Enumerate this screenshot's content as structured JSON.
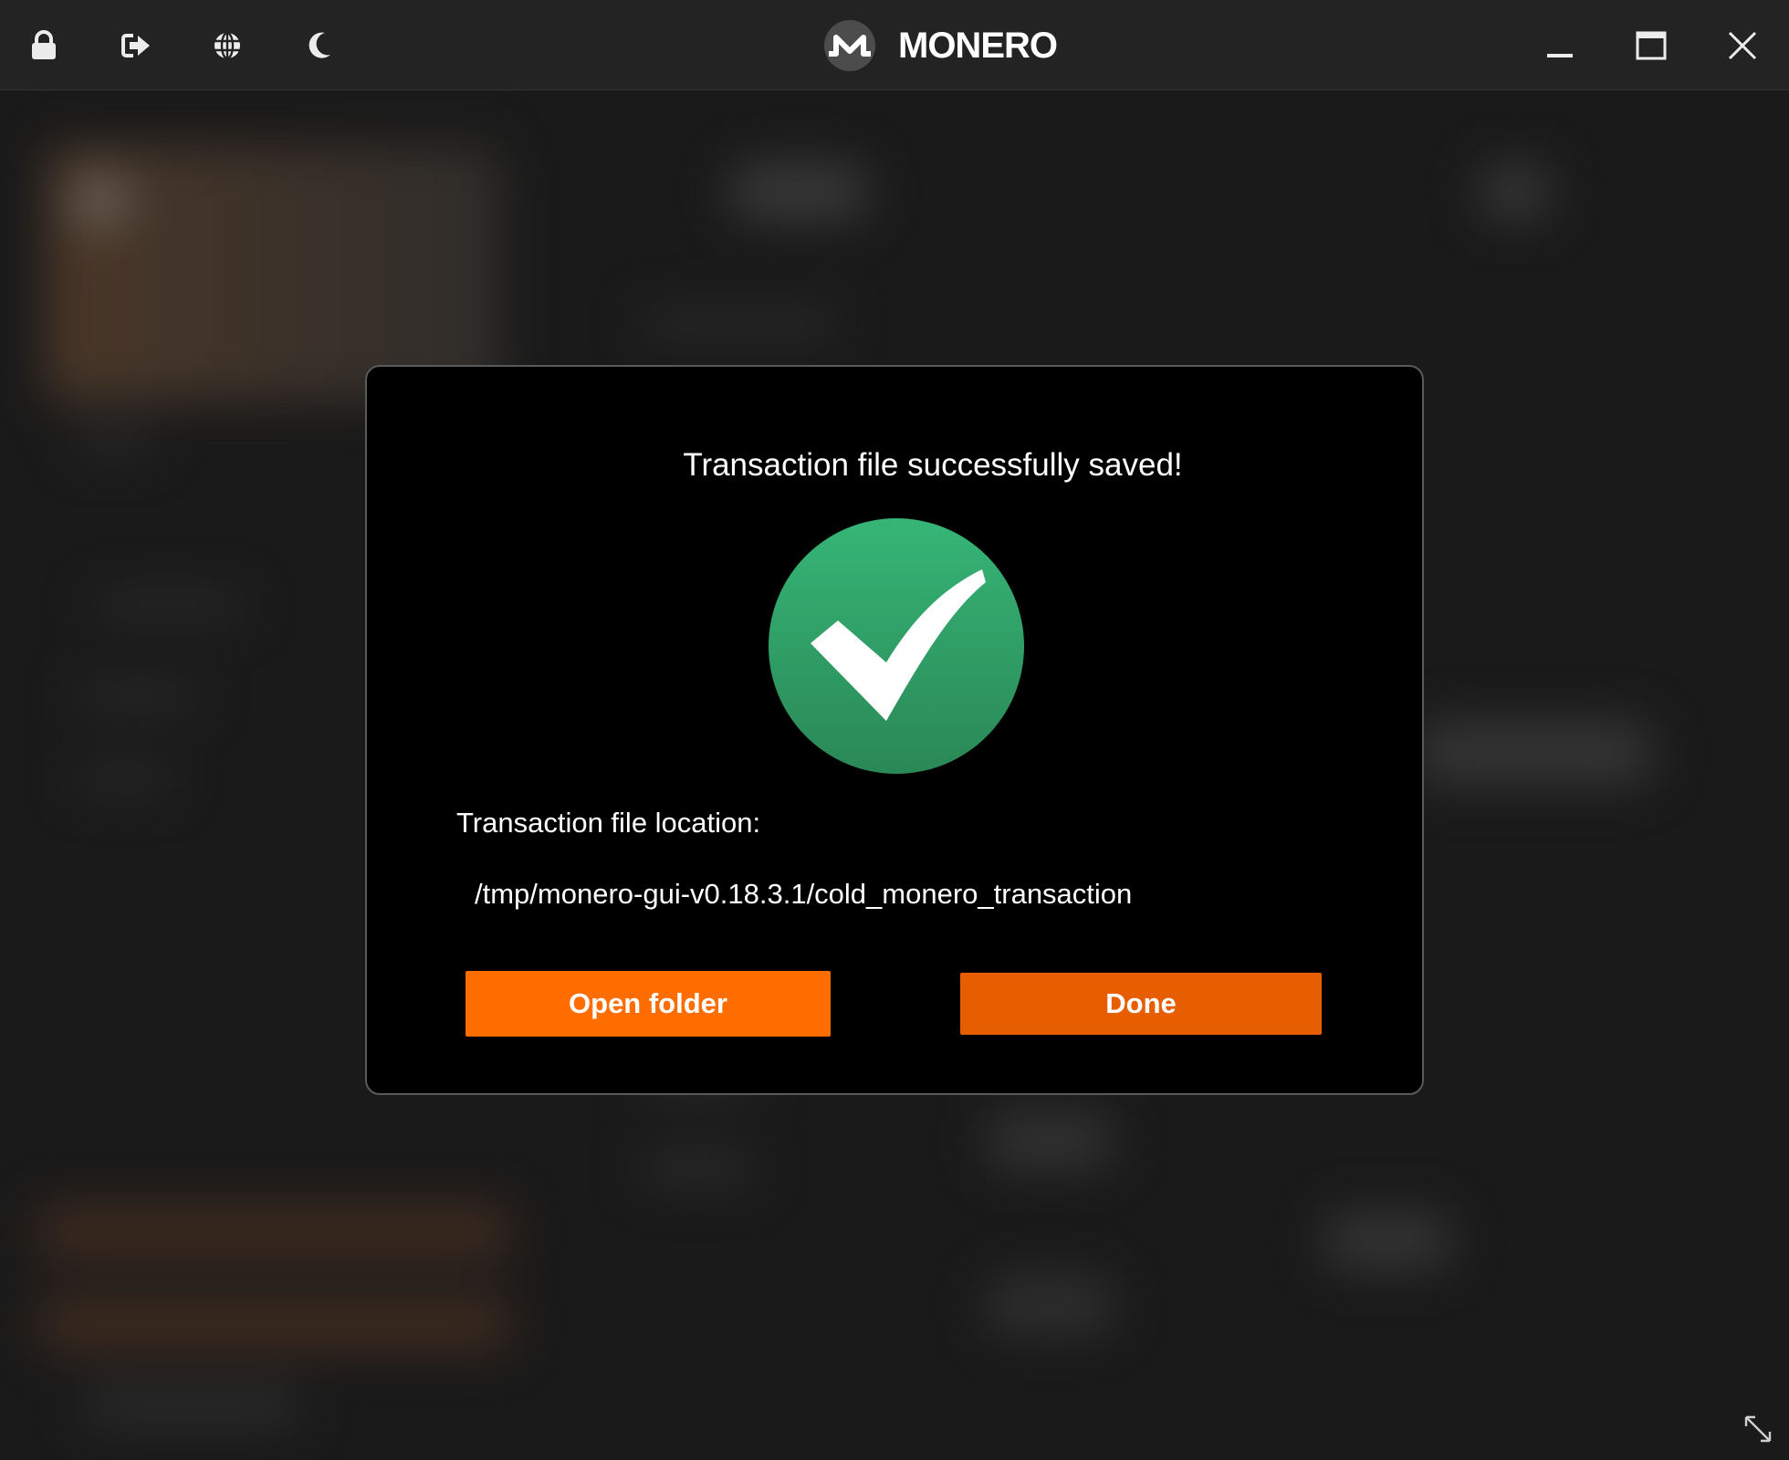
{
  "titlebar": {
    "brand_name": "MONERO",
    "left_icons": [
      "lock-icon",
      "logout-icon",
      "globe-icon",
      "moon-icon"
    ],
    "window_controls": [
      "minimize-icon",
      "maximize-icon",
      "close-icon"
    ]
  },
  "dialog": {
    "title": "Transaction file successfully saved!",
    "status_icon": "check-circle-icon",
    "location_label": "Transaction file location:",
    "location_path": "/tmp/monero-gui-v0.18.3.1/cold_monero_transaction",
    "open_folder_label": "Open folder",
    "done_label": "Done"
  },
  "colors": {
    "accent_orange": "#ff6c00",
    "done_orange": "#e65e00",
    "success_green": "#2f9e68",
    "titlebar_bg": "#232323",
    "dialog_bg": "#000000"
  }
}
